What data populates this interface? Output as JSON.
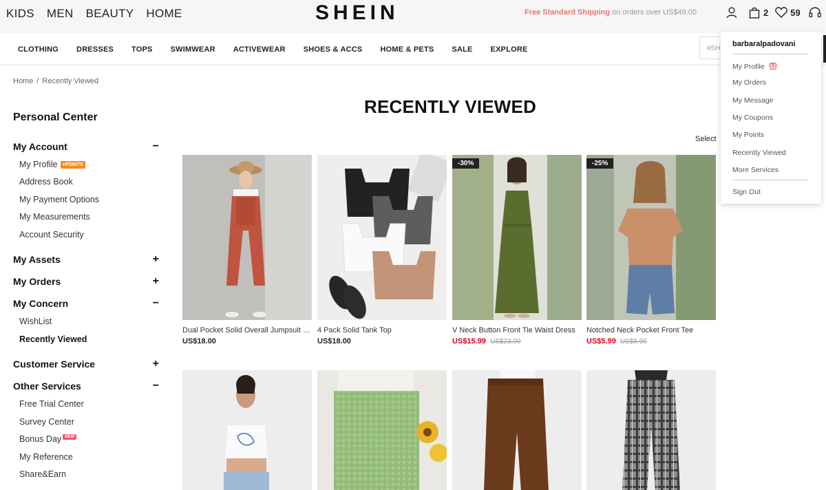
{
  "topbar": {
    "categories": [
      "KIDS",
      "MEN",
      "BEAUTY",
      "HOME"
    ],
    "logo": "SHEIN",
    "promo_highlight": "Free Standard Shipping",
    "promo_rest": " on orders over US$49.00",
    "icons": [
      "user-icon",
      "bag-icon",
      "heart-icon",
      "headset-icon"
    ],
    "bag_count": "2",
    "wishlist_count": "59"
  },
  "nav": {
    "items": [
      "CLOTHING",
      "DRESSES",
      "TOPS",
      "SWIMWEAR",
      "ACTIVEWEAR",
      "SHOES & ACCS",
      "HOME & PETS",
      "SALE",
      "EXPLORE"
    ],
    "search_text": "#SH"
  },
  "breadcrumb": {
    "home": "Home",
    "separator": "/",
    "current": "Recently Viewed"
  },
  "sidebar": {
    "title": "Personal Center",
    "sections": [
      {
        "label": "My Account",
        "toggle": "−"
      },
      {
        "label": "My Assets",
        "toggle": "+"
      },
      {
        "label": "My Orders",
        "toggle": "+"
      },
      {
        "label": "My Concern",
        "toggle": "−"
      },
      {
        "label": "Customer Service",
        "toggle": "+"
      },
      {
        "label": "Other Services",
        "toggle": "−"
      }
    ],
    "account_items": [
      "My Profile",
      "Address Book",
      "My Payment Options",
      "My Measurements",
      "Account Security"
    ],
    "points_tag": "+POINTS",
    "concern_items": [
      "WishList",
      "Recently Viewed"
    ],
    "other_items": [
      "Free Trial Center",
      "Survey Center",
      "Bonus Day",
      "My Reference",
      "Share&Earn"
    ],
    "new_tag": "NEW"
  },
  "main": {
    "title": "RECENTLY VIEWED",
    "select_label": "Select"
  },
  "products": [
    {
      "name": "Dual Pocket Solid Overall Jumpsuit Without Tee",
      "price": "US$18.00",
      "orig": "",
      "badge": ""
    },
    {
      "name": "4 Pack Solid Tank Top",
      "price": "US$18.00",
      "orig": "",
      "badge": ""
    },
    {
      "name": "V Neck Button Front Tie Waist Dress",
      "price": "US$15.99",
      "orig": "US$23.00",
      "badge": "-30%"
    },
    {
      "name": "Notched Neck Pocket Front Tee",
      "price": "US$5.99",
      "orig": "US$8.00",
      "badge": "-25%"
    }
  ],
  "dropdown": {
    "username": "barbaralpadovani",
    "items": [
      "My Profile",
      "My Orders",
      "My Message",
      "My Coupons",
      "My Points",
      "Recently Viewed",
      "More Services"
    ],
    "sign_out": "Sign Out"
  },
  "colors": {
    "sale_red": "#d6001c",
    "points_orange": "#f68b1f",
    "promo_pink": "#e8776b"
  }
}
